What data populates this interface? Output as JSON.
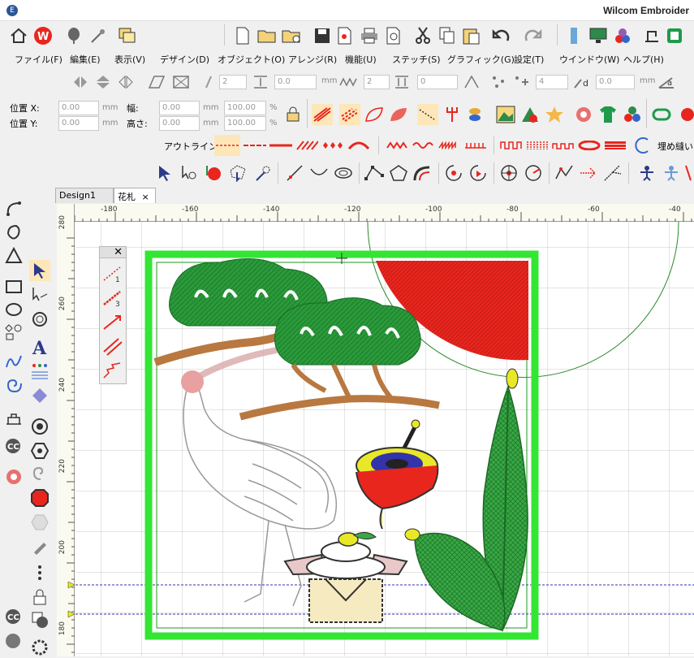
{
  "window": {
    "title": "Wilcom Embroider"
  },
  "menu": [
    "ファイル(F)",
    "編集(E)",
    "表示(V)",
    "デザイン(D)",
    "オブジェクト(O)",
    "アレンジ(R)",
    "機能(U)",
    "ステッチ(S)",
    "グラフィック(G)",
    "設定(T)",
    "ウインドウ(W)",
    "ヘルプ(H)"
  ],
  "toolbar_icons": {
    "home": "home-icon",
    "w": "wilcom-logo-icon",
    "new": "new-file-icon",
    "open": "open-folder-icon",
    "save": "save-icon",
    "cut": "cut-icon",
    "copy": "copy-icon",
    "paste": "paste-icon",
    "undo": "undo-icon",
    "redo": "redo-icon"
  },
  "props": {
    "pos_x_label": "位置 X:",
    "pos_y_label": "位置 Y:",
    "pos_x": "0.00",
    "pos_y": "0.00",
    "width_label": "幅:",
    "height_label": "高さ:",
    "width": "0.00",
    "height": "0.00",
    "unit": "mm",
    "pct_w": "100.00",
    "pct_h": "100.00",
    "pct": "%"
  },
  "params_row": {
    "v1": "2",
    "v2": "0.0",
    "unit_mm": "mm",
    "v3": "2",
    "v4": "0",
    "v5": "4",
    "v6": "0.0",
    "unit_mm2": "mm"
  },
  "outline": {
    "label": "アウトライン:",
    "fill_label": "埋め縫い:"
  },
  "tabs": [
    {
      "label": "Design1"
    },
    {
      "label": "花札"
    }
  ],
  "hruler": [
    {
      "label": "-180"
    },
    {
      "label": "-160"
    },
    {
      "label": "-140"
    },
    {
      "label": "-120"
    },
    {
      "label": "-100"
    },
    {
      "label": "-80"
    },
    {
      "label": "-60"
    },
    {
      "label": "-40"
    }
  ],
  "vruler": [
    {
      "label": "280"
    },
    {
      "label": "260"
    },
    {
      "label": "240"
    },
    {
      "label": "220"
    },
    {
      "label": "200"
    },
    {
      "label": "180"
    }
  ],
  "floating_panel": {
    "labels": [
      "1",
      "3"
    ]
  },
  "colors": {
    "frame": "#33e633",
    "sun": "#e8261e",
    "pine": "#2a9a3a",
    "branch": "#b87840"
  }
}
